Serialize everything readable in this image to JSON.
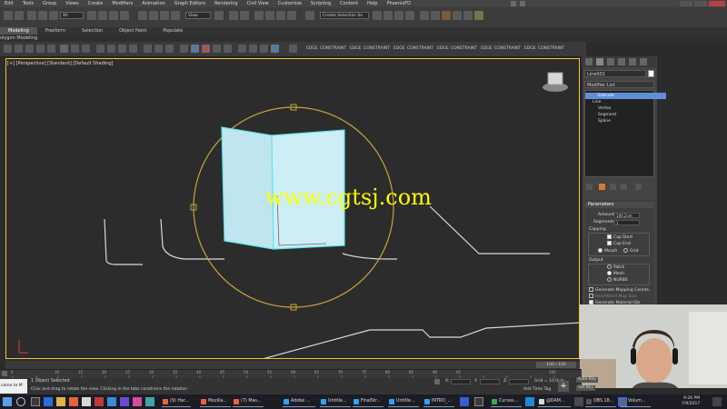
{
  "menu": [
    "Edit",
    "Tools",
    "Group",
    "Views",
    "Create",
    "Modifiers",
    "Animation",
    "Graph Editors",
    "Rendering",
    "Civil View",
    "Customize",
    "Scripting",
    "Content",
    "Help",
    "PhoenixFD"
  ],
  "toolbar": {
    "filter_dropdown": "All",
    "view_dropdown": "View",
    "selection_set": "Create Selection Se"
  },
  "ribbon_tabs": [
    "Modeling",
    "Freeform",
    "Selection",
    "Object Paint",
    "Populate"
  ],
  "ribbon_panel": "olygon Modeling",
  "sub_toolbar_labels": [
    "EDGE",
    "CONSTRAINT",
    "EDGE",
    "CONSTRAINT",
    "EDGE",
    "CONSTRAINT",
    "EDGE",
    "CONSTRAINT",
    "EDGE",
    "CONSTRAINT",
    "EDGE",
    "CONSTRAINT",
    "EDGE",
    "CONSTRAINT",
    "EDGE",
    "CONSTRAINT",
    "EDGE",
    "CONSTRAINT"
  ],
  "viewport": {
    "label": "[+] [Perspective] [Standard] [Default Shading]",
    "watermark": "www.cgtsj.com"
  },
  "command_panel": {
    "object_name": "Line001",
    "modifier_list": "Modifier List",
    "stack": [
      {
        "label": "Extrude",
        "selected": true
      },
      {
        "label": "Line",
        "selected": false
      },
      {
        "label": "Vertex",
        "selected": false
      },
      {
        "label": "Segment",
        "selected": false
      },
      {
        "label": "Spline",
        "selected": false
      }
    ],
    "parameters": {
      "title": "Parameters",
      "amount_label": "Amount:",
      "amount_value": "100.2cm",
      "segments_label": "Segments:",
      "segments_value": "1",
      "capping_label": "Capping",
      "cap_start": "Cap Start",
      "cap_end": "Cap End",
      "morph": "Morph",
      "grid": "Grid",
      "output_label": "Output",
      "patch": "Patch",
      "mesh": "Mesh",
      "nurbs": "NURBS",
      "gen_mapping": "Generate Mapping Coords.",
      "real_world": "Real-World Map Size",
      "gen_material": "Generate Material IDs",
      "smooth": "Sm"
    }
  },
  "timeline": {
    "frame_counter": "100 / 100",
    "ruler_ticks": [
      "0",
      "10",
      "15",
      "20",
      "25",
      "30",
      "35",
      "40",
      "45",
      "50",
      "55",
      "60",
      "65",
      "70",
      "75",
      "80",
      "85",
      "90",
      "95",
      "100"
    ]
  },
  "status": {
    "maxscript": "come to M",
    "selected": "1 Object Selected",
    "prompt": "Click and drag to rotate the view.  Clicking in the tabs constrains the rotation",
    "grid": "Grid = 10.0cm",
    "add_time_tag": "Add Time Tag",
    "auto_key": "Auto Key",
    "set_key": "Set Key",
    "x_label": "X:",
    "y_label": "Y:",
    "z_label": "Z:"
  },
  "taskbar": {
    "items": [
      {
        "label": "(9) Har...",
        "color": "#e8643a"
      },
      {
        "label": "Mozilla...",
        "color": "#e8643a"
      },
      {
        "label": "(7) Mas...",
        "color": "#e8643a"
      },
      {
        "label": "Adobe ...",
        "color": "#2fa3f5"
      },
      {
        "label": "Untitle...",
        "color": "#2fa3f5"
      },
      {
        "label": "FinalStr...",
        "color": "#2fa3f5"
      },
      {
        "label": "Untitle...",
        "color": "#2fa3f5"
      },
      {
        "label": "INTRO_...",
        "color": "#2fa3f5"
      },
      {
        "label": "Curves...",
        "color": "#3aa856"
      },
      {
        "label": "@DAM...",
        "color": "#d8d8d8"
      },
      {
        "label": "OBS 18...",
        "color": "#555"
      },
      {
        "label": "Volum...",
        "color": "#666"
      }
    ],
    "time": "9:26 PM",
    "date": "7/9/2017"
  },
  "colors": {
    "viewport_border": "#f0c23a",
    "selected_object": "#bfe6ee",
    "gizmo": "#c8a33a",
    "watermark": "#ffff00",
    "stack_selected": "#5f8fd8"
  }
}
